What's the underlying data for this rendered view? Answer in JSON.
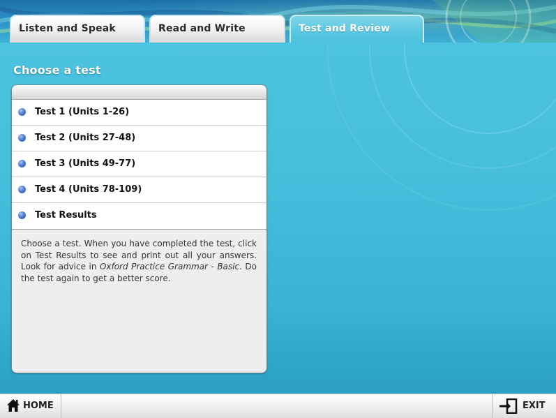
{
  "tabs": [
    {
      "label": "Listen and Speak",
      "active": false
    },
    {
      "label": "Read and Write",
      "active": false
    },
    {
      "label": "Test and Review",
      "active": true
    }
  ],
  "main": {
    "title": "Choose a test",
    "tests": [
      {
        "label": "Test 1 (Units 1-26)"
      },
      {
        "label": "Test 2 (Units 27-48)"
      },
      {
        "label": "Test 3 (Units 49-77)"
      },
      {
        "label": "Test 4 (Units 78-109)"
      },
      {
        "label": "Test Results"
      }
    ],
    "instructions": {
      "part1": "Choose a test. When you have completed the test, click on Test Results to see and print out all your answers. Look for advice in ",
      "book_title": "Oxford Practice Grammar - Basic",
      "part2": ". Do the test again to get a better score."
    }
  },
  "footer": {
    "home_label": "HOME",
    "exit_label": "EXIT"
  },
  "colors": {
    "background": "#45bedc",
    "active_tab": "#58c7e2",
    "bullet": "#4f7ed0"
  },
  "icons": {
    "bullet": "blue-ball-bullet-icon",
    "home": "home-icon",
    "exit": "exit-door-icon"
  }
}
